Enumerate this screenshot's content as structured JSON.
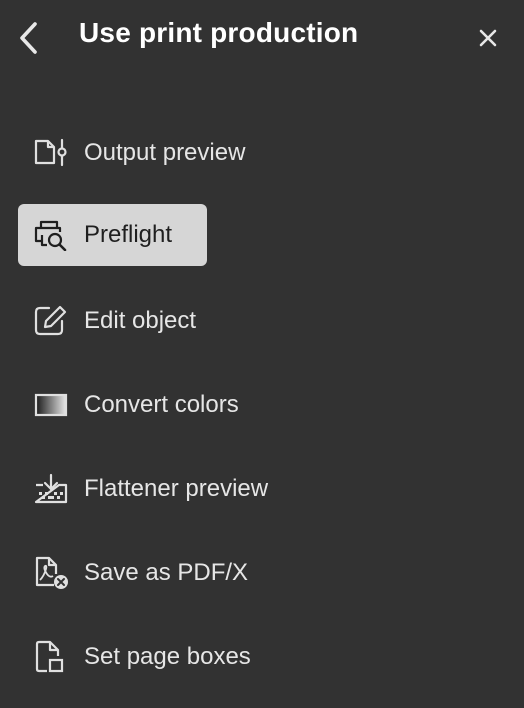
{
  "header": {
    "title": "Use print production",
    "back_icon": "chevron-left-icon",
    "close_icon": "close-icon"
  },
  "menu": {
    "items": [
      {
        "label": "Output preview",
        "icon": "output-preview-icon",
        "selected": false
      },
      {
        "label": "Preflight",
        "icon": "preflight-icon",
        "selected": true
      },
      {
        "label": "Edit object",
        "icon": "edit-object-icon",
        "selected": false
      },
      {
        "label": "Convert colors",
        "icon": "convert-colors-icon",
        "selected": false
      },
      {
        "label": "Flattener preview",
        "icon": "flattener-preview-icon",
        "selected": false
      },
      {
        "label": "Save as PDF/X",
        "icon": "save-pdfx-icon",
        "selected": false
      },
      {
        "label": "Set page boxes",
        "icon": "set-page-boxes-icon",
        "selected": false
      }
    ]
  },
  "colors": {
    "background": "#323232",
    "selected_background": "#d6d6d6",
    "text": "#e6e6e6",
    "selected_text": "#1f1f1f"
  }
}
